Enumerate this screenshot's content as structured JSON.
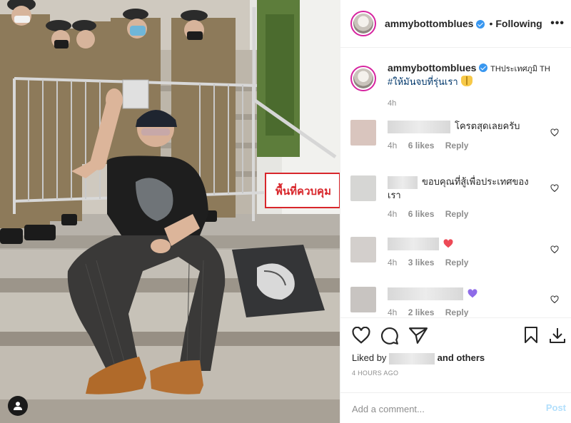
{
  "photo": {
    "sign_text": "พื้นที่ควบคุม",
    "user_tag_icon": "user-icon"
  },
  "header": {
    "username": "ammybottomblues",
    "separator": "•",
    "follow_status": "Following",
    "more_icon": "more-horizontal-icon",
    "more_label": "•••"
  },
  "caption": {
    "username": "ammybottomblues",
    "location": "THประเทศภูมิ TH",
    "hashtag": "#ให้มันจบที่รุ่นเรา",
    "emoji": "praying-hands",
    "time": "4h"
  },
  "comments": [
    {
      "text": "โครตสุดเลยครับ",
      "time": "4h",
      "likes": "6 likes",
      "reply": "Reply",
      "avatar_color": "#d9c5be"
    },
    {
      "text": "ขอบคุณที่สู้เพื่อประเทศของเรา",
      "time": "4h",
      "likes": "6 likes",
      "reply": "Reply",
      "avatar_color": "#d6d6d4"
    },
    {
      "text": "",
      "emoji_color": "#ed4956",
      "time": "4h",
      "likes": "3 likes",
      "reply": "Reply",
      "avatar_color": "#d3cfcc"
    },
    {
      "text": "",
      "emoji_color": "#8e6be8",
      "time": "4h",
      "likes": "2 likes",
      "reply": "Reply",
      "avatar_color": "#c8c4c1"
    }
  ],
  "actions": {
    "like_icon": "heart-icon",
    "comment_icon": "comment-icon",
    "share_icon": "send-icon",
    "save_icon": "bookmark-icon",
    "download_icon": "download-icon",
    "liked_by_prefix": "Liked by",
    "liked_by_suffix": "and others",
    "post_time": "4 HOURS AGO"
  },
  "add_comment": {
    "placeholder": "Add a comment...",
    "post_label": "Post"
  },
  "colors": {
    "accent": "#3897f0",
    "link": "#00376b",
    "secondary_text": "#8e8e8e",
    "post_disabled": "#b2dffc",
    "sign_red": "#d8262b"
  }
}
